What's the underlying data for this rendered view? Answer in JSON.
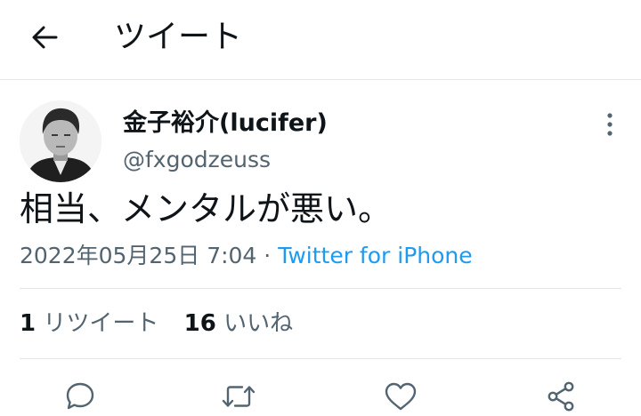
{
  "header": {
    "title": "ツイート",
    "back_icon": "arrow-left-icon"
  },
  "tweet": {
    "user_name": "金子裕介(lucifer)",
    "user_handle": "@fxgodzeuss",
    "text": "相当、メンタルが悪い。",
    "date": "2022年05月25日 7:04",
    "separator": " · ",
    "source": "Twitter for iPhone"
  },
  "stats": {
    "retweets_count": "1",
    "retweets_label": "リツイート",
    "likes_count": "16",
    "likes_label": "いいね"
  },
  "actions": {
    "icons": [
      "reply-icon",
      "retweet-icon",
      "like-icon",
      "share-icon"
    ]
  },
  "colors": {
    "text": "#0f1419",
    "secondary": "#536471",
    "link": "#1d9bf0",
    "divider": "#e6e6e6"
  }
}
